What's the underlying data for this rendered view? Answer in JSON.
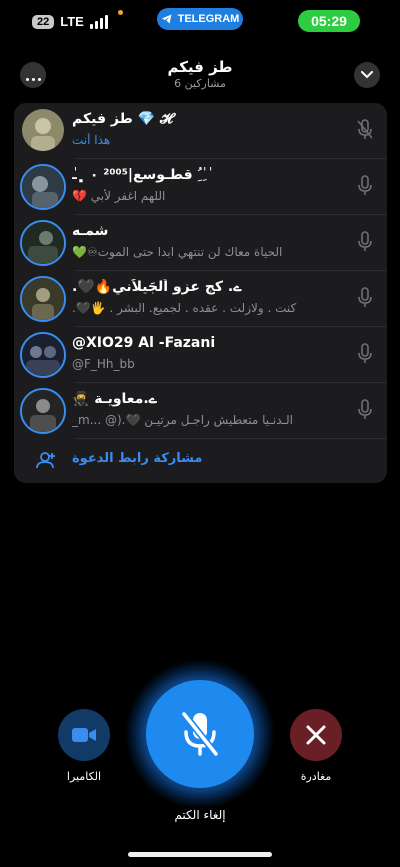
{
  "status_bar": {
    "battery": "22",
    "carrier": "LTE",
    "app_pill": "TELEGRAM",
    "time": "05:29"
  },
  "header": {
    "title": "طز فيكم",
    "subtitle": "6 مشاركين"
  },
  "participants": [
    {
      "name": "𝓗 💎 طز فيكم",
      "status": "هذا أنت",
      "status_style": "you",
      "mic": "muted"
    },
    {
      "name": "ٰ ِٰ ُِٰ قطـوسع|²⁰⁰⁵ ۰ ﮼ـٰ",
      "status": "اللهم اغفر لأبي 💔",
      "mic": "on"
    },
    {
      "name": "شمـه",
      "status": "الحياة معاك لن تنتهي ابدا حتى الموت♾💚",
      "mic": "on"
    },
    {
      "name": "ے. كج عزو اَلجَيلاَني🔥🖤.",
      "status": "كنت . ولازلت . عقده . لجميع. البشر . 🖐🖤.",
      "mic": "on"
    },
    {
      "name": "@XIO29 Al -Fazani",
      "status": "@F_Hh_bb",
      "mic": "on",
      "ltr": true
    },
    {
      "name": "ے.معاويـة 🥷",
      "status": "الـدنـيا متعطيش راجـل مرتيـن 🖤.(@ ...m_",
      "mic": "on"
    }
  ],
  "invite": {
    "label": "مشاركة رابط الدعوة"
  },
  "controls": {
    "camera_label": "الكاميرا",
    "unmute_label": "إلغاء الكتم",
    "leave_label": "مغادرة"
  },
  "colors": {
    "accent": "#3a8df0",
    "mute_button": "#1e8af0",
    "leave_button": "#6a1f26",
    "camera_button": "#123a66",
    "time_pill": "#2ecc40",
    "app_pill": "#1f7fe0"
  },
  "icons": {
    "more": "more-icon",
    "collapse": "chevron-down-icon",
    "mic": "mic-icon",
    "mic_off": "mic-off-icon",
    "camera": "video-camera-icon",
    "close": "close-icon",
    "invite": "add-user-icon",
    "telegram": "telegram-icon"
  }
}
